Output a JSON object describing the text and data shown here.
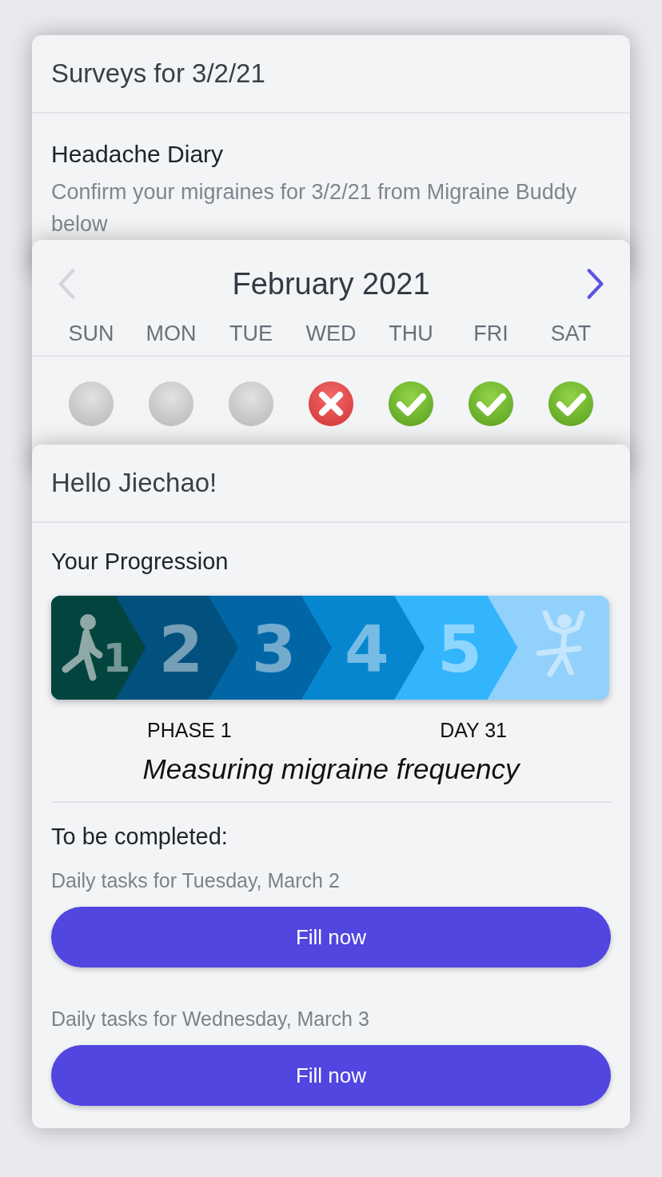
{
  "surveys_card": {
    "title": "Surveys for 3/2/21",
    "survey": {
      "name": "Headache Diary",
      "description": "Confirm your migraines for 3/2/21 from Migraine Buddy below"
    }
  },
  "calendar": {
    "month": "February 2021",
    "prev": {
      "disabled": true
    },
    "next": {
      "disabled": false
    },
    "weekdays": [
      "SUN",
      "MON",
      "TUE",
      "WED",
      "THU",
      "FRI",
      "SAT"
    ],
    "days": [
      {
        "kind": "none"
      },
      {
        "kind": "none"
      },
      {
        "kind": "none"
      },
      {
        "kind": "missed"
      },
      {
        "kind": "done"
      },
      {
        "kind": "done"
      },
      {
        "kind": "done"
      }
    ]
  },
  "home": {
    "greeting": "Hello Jiechao!",
    "progression_title": "Your Progression",
    "steps": [
      {
        "label": "1",
        "selected": true,
        "color": "#03443f"
      },
      {
        "label": "2",
        "selected": false,
        "color": "#02507d"
      },
      {
        "label": "3",
        "selected": false,
        "color": "#0166a6"
      },
      {
        "label": "4",
        "selected": false,
        "color": "#0786d0"
      },
      {
        "label": "5",
        "selected": false,
        "color": "#33b5fd"
      }
    ],
    "phase": "PHASE 1",
    "day": "DAY 31",
    "phase_description": "Measuring migraine frequency",
    "todo_title": "To be completed:",
    "tasks": [
      {
        "label": "Daily tasks for Tuesday, March 2",
        "button": "Fill now"
      },
      {
        "label": "Daily tasks for Wednesday, March 3",
        "button": "Fill now"
      }
    ]
  }
}
